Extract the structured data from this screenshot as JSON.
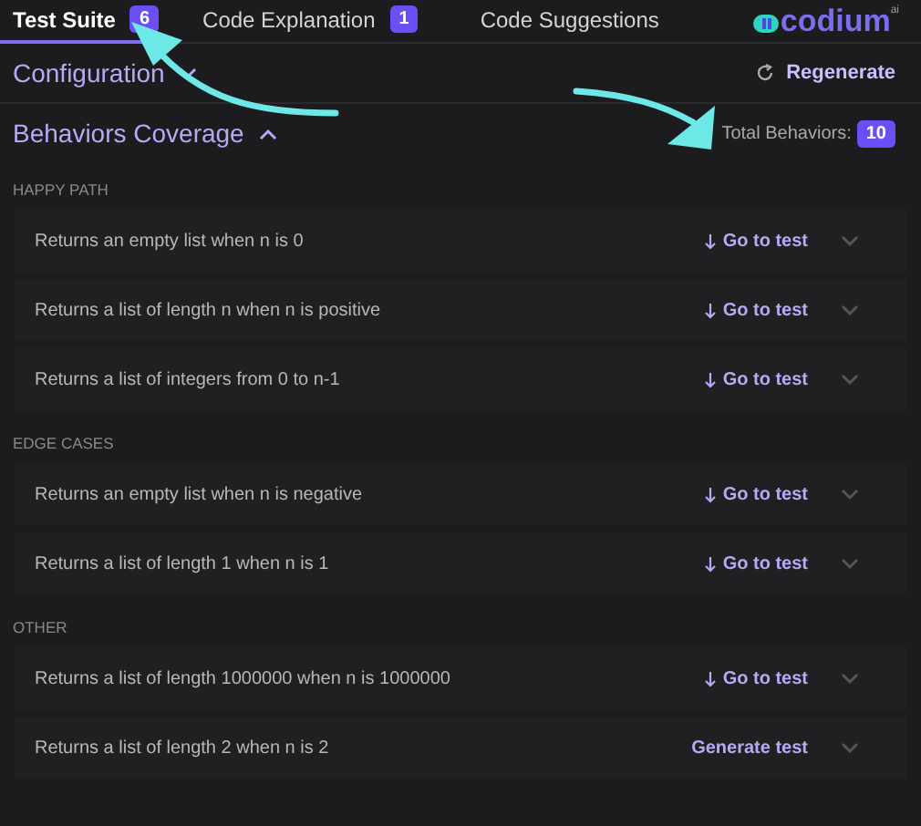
{
  "tabs": [
    {
      "label": "Test Suite",
      "count": "6",
      "selected": true
    },
    {
      "label": "Code Explanation",
      "count": "1",
      "selected": false
    },
    {
      "label": "Code Suggestions",
      "selected": false
    }
  ],
  "logo": {
    "text": "codium",
    "superscript": "ai"
  },
  "configuration": {
    "title": "Configuration",
    "expanded": false,
    "action": "Regenerate"
  },
  "coverage": {
    "title": "Behaviors Coverage",
    "expanded": true,
    "total_label": "Total Behaviors:",
    "total": "10"
  },
  "groups": [
    {
      "title": "HAPPY PATH",
      "behaviors": [
        {
          "text": "Returns an empty list when n is 0",
          "kind": "go",
          "action": "Go to test"
        },
        {
          "text": "Returns a list of length n when n is positive",
          "kind": "go",
          "action": "Go to test"
        },
        {
          "text": "Returns a list of integers from 0 to n-1",
          "kind": "go",
          "action": "Go to test"
        }
      ]
    },
    {
      "title": "EDGE CASES",
      "behaviors": [
        {
          "text": "Returns an empty list when n is negative",
          "kind": "go",
          "action": "Go to test"
        },
        {
          "text": "Returns a list of length 1 when n is 1",
          "kind": "go",
          "action": "Go to test"
        }
      ]
    },
    {
      "title": "OTHER",
      "behaviors": [
        {
          "text": "Returns a list of length 1000000 when n is 1000000",
          "kind": "go",
          "action": "Go to test"
        },
        {
          "text": "Returns a list of length 2 when n is 2",
          "kind": "generate",
          "action": "Generate test"
        }
      ]
    }
  ]
}
